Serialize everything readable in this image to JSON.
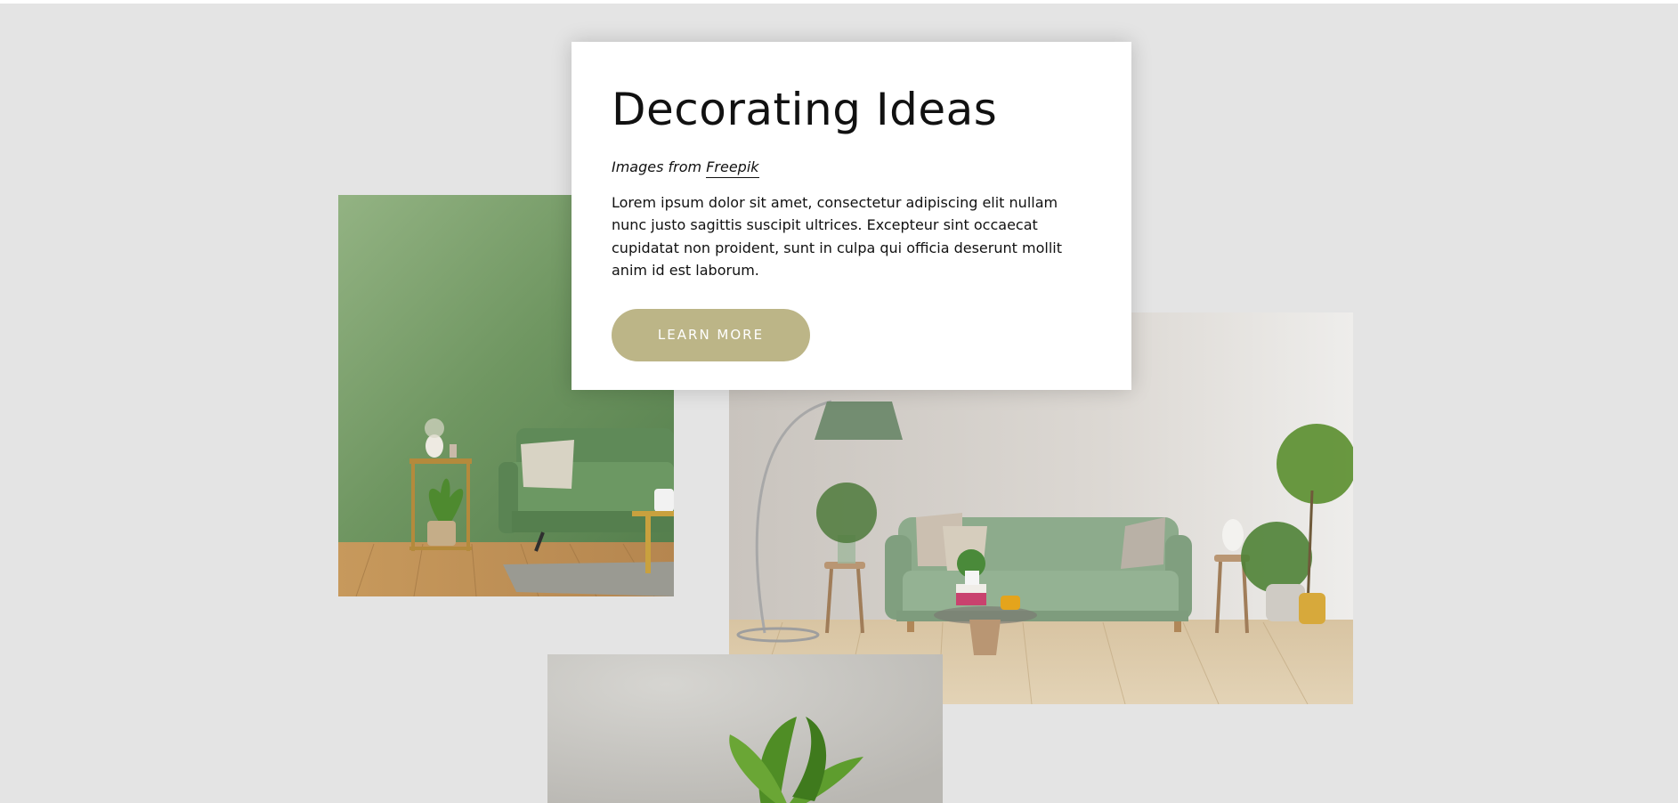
{
  "card": {
    "title": "Decorating Ideas",
    "credit_prefix": "Images from ",
    "credit_link": "Freepik",
    "body": "Lorem ipsum dolor sit amet, consectetur adipiscing elit nullam nunc justo sagittis suscipit ultrices. Excepteur sint occaecat cupidatat non proident, sunt in culpa qui officia deserunt mollit anim id est laborum.",
    "button_label": "LEARN MORE"
  },
  "colors": {
    "background": "#e4e4e4",
    "card": "#ffffff",
    "button": "#bcb587",
    "button_text": "#ffffff",
    "green_wall": "#6f9661",
    "sofa_green": "#8aa88a"
  },
  "images": [
    {
      "subject": "green living room with sofa and side table"
    },
    {
      "subject": "beige living room with green sofa and floor lamp"
    },
    {
      "subject": "potted green plant against grey wall"
    }
  ]
}
